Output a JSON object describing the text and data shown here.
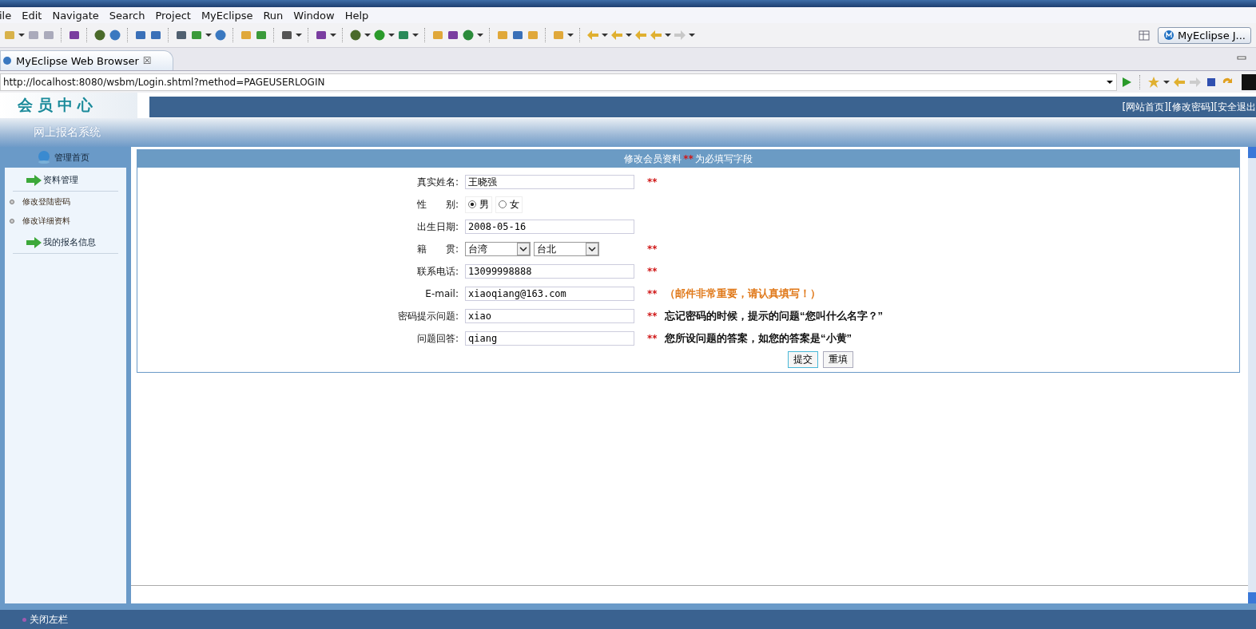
{
  "menu": [
    "ile",
    "Edit",
    "Navigate",
    "Search",
    "Project",
    "MyEclipse",
    "Run",
    "Window",
    "Help"
  ],
  "perspective": {
    "label": "MyEclipse J..."
  },
  "editor_tab": {
    "label": "MyEclipse Web Browser",
    "close": "☒"
  },
  "address": {
    "value": "http://localhost:8080/wsbm/Login.shtml?method=PAGEUSERLOGIN"
  },
  "site": {
    "logo": "会员中心",
    "subtitle": "网上报名系统",
    "top_links": [
      "[网站首页]",
      "[修改密码]",
      "[安全退出"
    ]
  },
  "sidebar": {
    "home": "管理首页",
    "sections": [
      {
        "title": "资料管理",
        "items": [
          "修改登陆密码",
          "修改详细资料"
        ]
      },
      {
        "title": "我的报名信息"
      }
    ]
  },
  "form": {
    "title": "修改会员资料",
    "required_mark": "**",
    "required_note": "为必填写字段",
    "rows": [
      {
        "kind": "text",
        "label": "真实姓名:",
        "value": "王晓强",
        "required": true
      },
      {
        "kind": "radio",
        "label": "性　　别:",
        "options": [
          {
            "label": "男",
            "selected": true
          },
          {
            "label": "女",
            "selected": false
          }
        ]
      },
      {
        "kind": "text",
        "label": "出生日期:",
        "value": "2008-05-16",
        "required": false
      },
      {
        "kind": "select",
        "label": "籍　　贯:",
        "selects": [
          "台湾",
          "台北"
        ],
        "required": true
      },
      {
        "kind": "text",
        "label": "联系电话:",
        "value": "13099998888",
        "required": true
      },
      {
        "kind": "text",
        "label": "E-mail:",
        "value": "xiaoqiang@163.com",
        "required": true,
        "hint": "（邮件非常重要，请认真填写！）",
        "color": "#e07818"
      },
      {
        "kind": "text",
        "label": "密码提示问题:",
        "value": "xiao",
        "required": true,
        "hint": "忘记密码的时候，提示的问题“您叫什么名字？”",
        "color": "#111111"
      },
      {
        "kind": "text",
        "label": "问题回答:",
        "value": "qiang",
        "required": true,
        "hint": "您所设问题的答案，如您的答案是“小黄”",
        "color": "#111111"
      }
    ],
    "buttons": [
      "提交",
      "重填"
    ]
  },
  "footer": {
    "label": "关闭左栏"
  }
}
